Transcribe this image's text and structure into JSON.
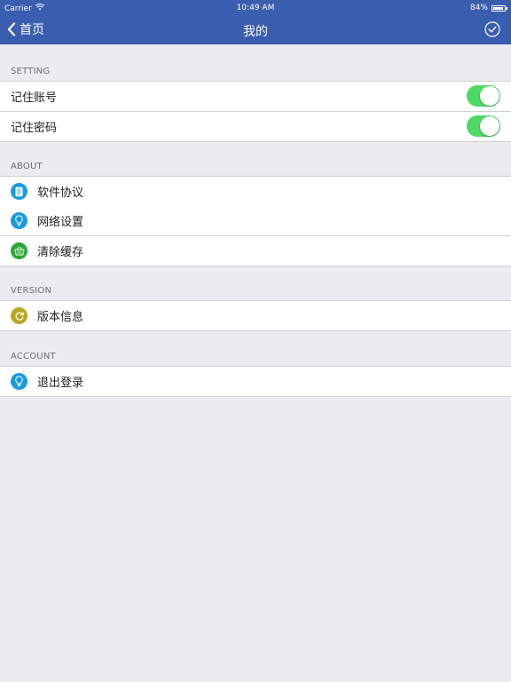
{
  "status_bar": {
    "carrier": "Carrier",
    "time": "10:49 AM",
    "battery": "84%",
    "battery_level": 0.84
  },
  "nav": {
    "back_label": "首页",
    "title": "我的"
  },
  "sections": {
    "setting": {
      "header": "SETTING",
      "items": [
        {
          "label": "记住账号",
          "toggle_on": true
        },
        {
          "label": "记住密码",
          "toggle_on": true
        }
      ]
    },
    "about": {
      "header": "ABOUT",
      "items": [
        {
          "label": "软件协议",
          "icon": "document-icon"
        },
        {
          "label": "网络设置",
          "icon": "lightbulb-icon"
        },
        {
          "label": "清除缓存",
          "icon": "basket-icon"
        }
      ]
    },
    "version": {
      "header": "VERSION",
      "items": [
        {
          "label": "版本信息",
          "icon": "refresh-icon"
        }
      ]
    },
    "account": {
      "header": "ACCOUNT",
      "items": [
        {
          "label": "退出登录",
          "icon": "lightbulb-icon"
        }
      ]
    }
  },
  "colors": {
    "nav_bg": "#3b5db0",
    "toggle_on": "#4cd964",
    "icon_blue": "#1a9be0",
    "icon_green": "#2aa836",
    "icon_olive": "#b8a820"
  }
}
